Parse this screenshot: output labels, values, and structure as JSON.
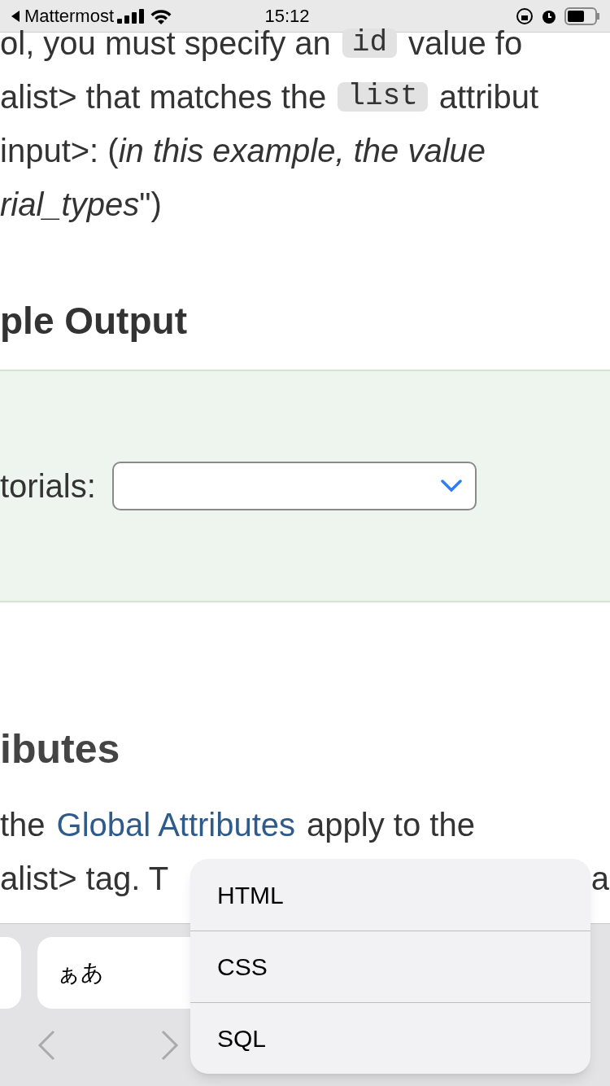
{
  "status_bar": {
    "back_label": "Mattermost",
    "time": "15:12"
  },
  "intro": {
    "lines": [
      [
        {
          "kind": "text",
          "text": "ol, you must specify an"
        },
        {
          "kind": "code",
          "text": "id"
        },
        {
          "kind": "text",
          "text": "value fo"
        }
      ],
      [
        {
          "kind": "text",
          "text": "alist> that matches the"
        },
        {
          "kind": "code",
          "text": "list"
        },
        {
          "kind": "text",
          "text": "attribut"
        }
      ],
      [
        {
          "kind": "text",
          "text": "input>: (*in this example, the value*"
        }
      ],
      [
        {
          "kind": "text",
          "text": "*rial_types*\")"
        }
      ]
    ]
  },
  "output_heading": "ple Output",
  "example": {
    "label": "torials:"
  },
  "attributes_heading": "ibutes",
  "attributes": {
    "lines": [
      [
        {
          "kind": "text",
          "text": "the"
        },
        {
          "kind": "link",
          "text": "Global Attributes"
        },
        {
          "kind": "text",
          "text": "apply to the"
        }
      ],
      [
        {
          "kind": "text",
          "text": "alist> tag. T"
        },
        {
          "kind": "text",
          "text": "a"
        }
      ]
    ]
  },
  "keyboard_bar": {
    "keys": [
      {
        "kind": "blank"
      },
      {
        "kind": "label",
        "text": "ぁあ"
      }
    ]
  },
  "menu": {
    "options": [
      "HTML",
      "CSS",
      "SQL"
    ]
  }
}
